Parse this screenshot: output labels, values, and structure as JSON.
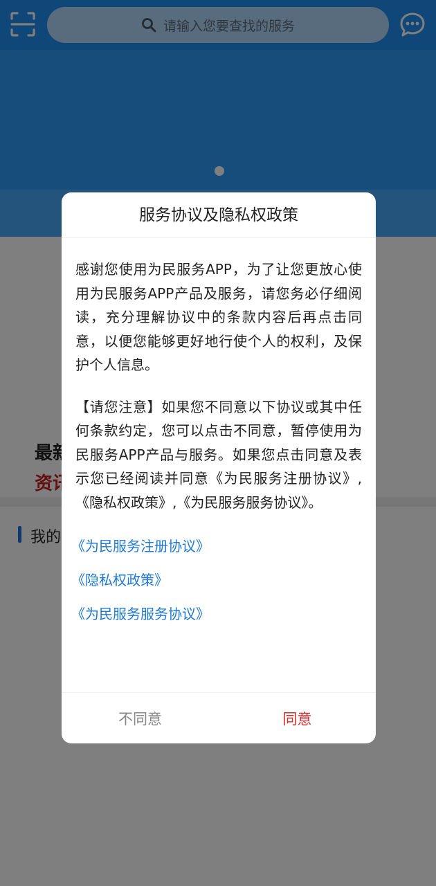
{
  "header": {
    "scan_icon": "scan-icon",
    "search_placeholder": "请输入您要查找的服务",
    "search_icon": "search-icon",
    "message_icon": "chat-bubble-icon",
    "accent_color": "#1f8ff3"
  },
  "banner": {
    "page_indicator_active": 1,
    "page_indicator_total": 1
  },
  "background": {
    "news_title_partial": "最新",
    "news_sub_partial": "资讯",
    "section_title_partial": "我的"
  },
  "dialog": {
    "title": "服务协议及隐私权政策",
    "paragraph1": "感谢您使用为民服务APP，为了让您更放心使用为民服务APP产品及服务，请您务必仔细阅读，充分理解协议中的条款内容后再点击同意，以便您能够更好地行使个人的权利，及保护个人信息。",
    "paragraph2": "【请您注意】如果您不同意以下协议或其中任何条款约定，您可以点击不同意，暂停使用为民服务APP产品与服务。如果您点击同意及表示您已经阅读并同意《为民服务注册协议》,《隐私权政策》,《为民服务服务协议》。",
    "links": [
      "《为民服务注册协议》",
      "《隐私权政策》",
      "《为民服务服务协议》"
    ],
    "disagree_label": "不同意",
    "agree_label": "同意",
    "link_color": "#1f78d1",
    "agree_color": "#d42b2b"
  }
}
